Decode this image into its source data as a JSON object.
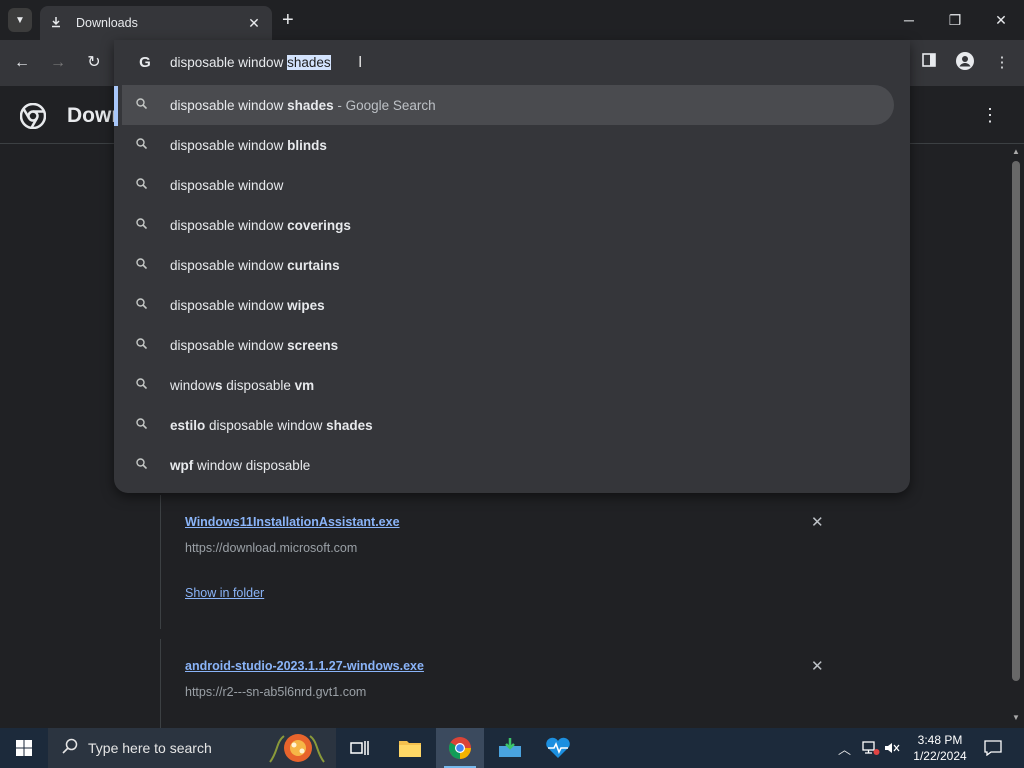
{
  "tab": {
    "title": "Downloads",
    "close": "✕"
  },
  "window_controls": {
    "minimize": "─",
    "maximize": "❐",
    "close": "✕"
  },
  "page": {
    "title": "Downl"
  },
  "omnibox": {
    "typed": "disposable window ",
    "selected": "shades",
    "suggestions": [
      {
        "parts": [
          [
            "disposable window ",
            false
          ],
          [
            "shades",
            true
          ]
        ],
        "suffix": " - Google Search"
      },
      {
        "parts": [
          [
            "disposable window ",
            false
          ],
          [
            "blinds",
            true
          ]
        ],
        "suffix": ""
      },
      {
        "parts": [
          [
            "disposable window",
            false
          ]
        ],
        "suffix": ""
      },
      {
        "parts": [
          [
            "disposable window ",
            false
          ],
          [
            "coverings",
            true
          ]
        ],
        "suffix": ""
      },
      {
        "parts": [
          [
            "disposable window ",
            false
          ],
          [
            "curtains",
            true
          ]
        ],
        "suffix": ""
      },
      {
        "parts": [
          [
            "disposable window ",
            false
          ],
          [
            "wipes",
            true
          ]
        ],
        "suffix": ""
      },
      {
        "parts": [
          [
            "disposable window ",
            false
          ],
          [
            "screens",
            true
          ]
        ],
        "suffix": ""
      },
      {
        "parts": [
          [
            "window",
            false
          ],
          [
            "s",
            true
          ],
          [
            " disposable ",
            false
          ],
          [
            "vm",
            true
          ]
        ],
        "suffix": ""
      },
      {
        "parts": [
          [
            "estilo",
            true
          ],
          [
            " disposable window ",
            false
          ],
          [
            "shades",
            true
          ]
        ],
        "suffix": ""
      },
      {
        "parts": [
          [
            "wpf",
            true
          ],
          [
            " window disposable",
            false
          ]
        ],
        "suffix": ""
      }
    ]
  },
  "downloads": [
    {
      "filename": "Windows11InstallationAssistant.exe",
      "url": "https://download.microsoft.com",
      "action": "Show in folder"
    },
    {
      "filename": "android-studio-2023.1.1.27-windows.exe",
      "url": "https://r2---sn-ab5l6nrd.gvt1.com"
    }
  ],
  "taskbar": {
    "search_placeholder": "Type here to search",
    "time": "3:48 PM",
    "date": "1/22/2024"
  },
  "colors": {
    "accent": "#8ab4f8",
    "selection": "#d3e3fd",
    "taskbar": "#1c2a3b"
  }
}
